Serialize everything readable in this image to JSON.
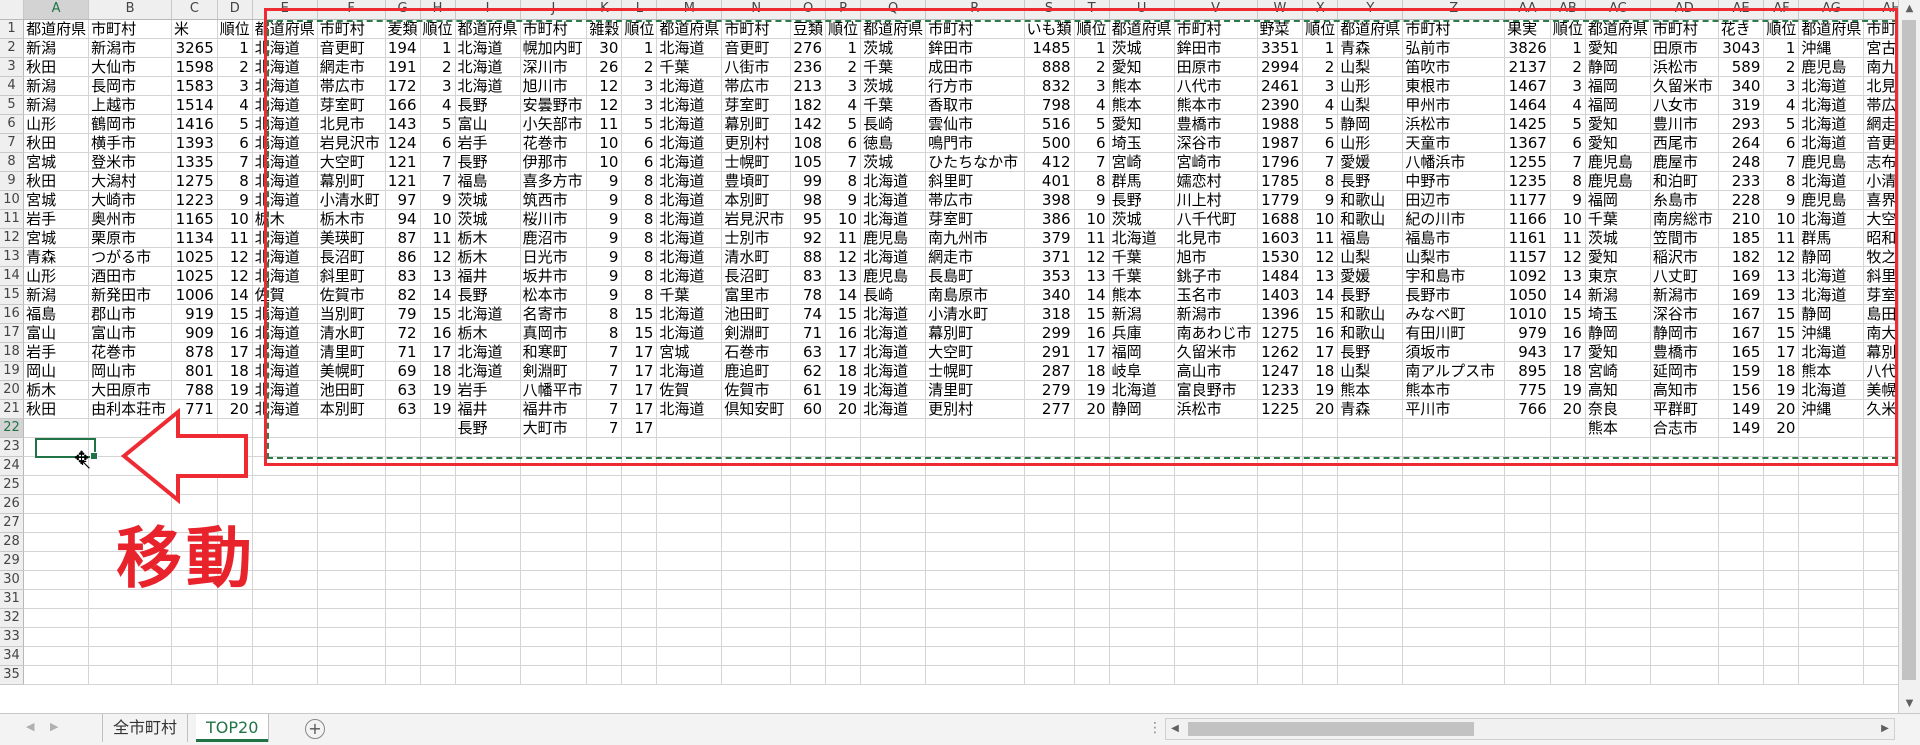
{
  "columns": [
    "A",
    "B",
    "C",
    "D",
    "E",
    "F",
    "G",
    "H",
    "I",
    "J",
    "K",
    "L",
    "M",
    "N",
    "O",
    "P",
    "Q",
    "R",
    "S",
    "T",
    "U",
    "V",
    "W",
    "X",
    "Y",
    "Z",
    "AA",
    "AB",
    "AC",
    "AD",
    "AE",
    "AF",
    "AG",
    "AH"
  ],
  "grid": {
    "active_cell": "A22",
    "rows": [
      [
        "都道府県",
        "市町村",
        "米",
        "順位",
        "都道府県",
        "市町村",
        "麦類",
        "順位",
        "都道府県",
        "市町村",
        "雑穀",
        "順位",
        "都道府県",
        "市町村",
        "豆類",
        "順位",
        "都道府県",
        "市町村",
        "いも類",
        "順位",
        "都道府県",
        "市町村",
        "野菜",
        "順位",
        "都道府県",
        "市町村",
        "果実",
        "順位",
        "都道府県",
        "市町村",
        "花き",
        "順位",
        "都道府県",
        "市町村"
      ],
      [
        "新潟",
        "新潟市",
        "3265",
        "1",
        "北海道",
        "音更町",
        "194",
        "1",
        "北海道",
        "幌加内町",
        "30",
        "1",
        "北海道",
        "音更町",
        "276",
        "1",
        "茨城",
        "鉾田市",
        "1485",
        "1",
        "茨城",
        "鉾田市",
        "3351",
        "1",
        "青森",
        "弘前市",
        "3826",
        "1",
        "愛知",
        "田原市",
        "3043",
        "1",
        "沖縄",
        "宮古島"
      ],
      [
        "秋田",
        "大仙市",
        "1598",
        "2",
        "北海道",
        "網走市",
        "191",
        "2",
        "北海道",
        "深川市",
        "26",
        "2",
        "千葉",
        "八街市",
        "236",
        "2",
        "千葉",
        "成田市",
        "888",
        "2",
        "愛知",
        "田原市",
        "2994",
        "2",
        "山梨",
        "笛吹市",
        "2137",
        "2",
        "静岡",
        "浜松市",
        "589",
        "2",
        "鹿児島",
        "南九州"
      ],
      [
        "新潟",
        "長岡市",
        "1583",
        "3",
        "北海道",
        "帯広市",
        "172",
        "3",
        "北海道",
        "旭川市",
        "12",
        "3",
        "北海道",
        "帯広市",
        "213",
        "3",
        "茨城",
        "行方市",
        "832",
        "3",
        "熊本",
        "八代市",
        "2461",
        "3",
        "山形",
        "東根市",
        "1467",
        "3",
        "福岡",
        "久留米市",
        "340",
        "3",
        "北海道",
        "北見市"
      ],
      [
        "新潟",
        "上越市",
        "1514",
        "4",
        "北海道",
        "芽室町",
        "166",
        "4",
        "長野",
        "安曇野市",
        "12",
        "3",
        "北海道",
        "芽室町",
        "182",
        "4",
        "千葉",
        "香取市",
        "798",
        "4",
        "熊本",
        "熊本市",
        "2390",
        "4",
        "山梨",
        "甲州市",
        "1464",
        "4",
        "福岡",
        "八女市",
        "319",
        "4",
        "北海道",
        "帯広市"
      ],
      [
        "山形",
        "鶴岡市",
        "1416",
        "5",
        "北海道",
        "北見市",
        "143",
        "5",
        "富山",
        "小矢部市",
        "11",
        "5",
        "北海道",
        "幕別町",
        "142",
        "5",
        "長崎",
        "雲仙市",
        "516",
        "5",
        "愛知",
        "豊橋市",
        "1988",
        "5",
        "静岡",
        "浜松市",
        "1425",
        "5",
        "愛知",
        "豊川市",
        "293",
        "5",
        "北海道",
        "網走市"
      ],
      [
        "秋田",
        "横手市",
        "1393",
        "6",
        "北海道",
        "岩見沢市",
        "124",
        "6",
        "岩手",
        "花巻市",
        "10",
        "6",
        "北海道",
        "更別村",
        "108",
        "6",
        "徳島",
        "鳴門市",
        "500",
        "6",
        "埼玉",
        "深谷市",
        "1987",
        "6",
        "山形",
        "天童市",
        "1367",
        "6",
        "愛知",
        "西尾市",
        "264",
        "6",
        "北海道",
        "音更町"
      ],
      [
        "宮城",
        "登米市",
        "1335",
        "7",
        "北海道",
        "大空町",
        "121",
        "7",
        "長野",
        "伊那市",
        "10",
        "6",
        "北海道",
        "士幌町",
        "105",
        "7",
        "茨城",
        "ひたちなか市",
        "412",
        "7",
        "宮崎",
        "宮崎市",
        "1796",
        "7",
        "愛媛",
        "八幡浜市",
        "1255",
        "7",
        "鹿児島",
        "鹿屋市",
        "248",
        "7",
        "鹿児島",
        "志布志"
      ],
      [
        "秋田",
        "大潟村",
        "1275",
        "8",
        "北海道",
        "幕別町",
        "121",
        "7",
        "福島",
        "喜多方市",
        "9",
        "8",
        "北海道",
        "豊頃町",
        "99",
        "8",
        "北海道",
        "斜里町",
        "401",
        "8",
        "群馬",
        "嬬恋村",
        "1785",
        "8",
        "長野",
        "中野市",
        "1235",
        "8",
        "鹿児島",
        "和泊町",
        "233",
        "8",
        "北海道",
        "小清水"
      ],
      [
        "宮城",
        "大崎市",
        "1223",
        "9",
        "北海道",
        "小清水町",
        "97",
        "9",
        "茨城",
        "筑西市",
        "9",
        "8",
        "北海道",
        "本別町",
        "98",
        "9",
        "北海道",
        "帯広市",
        "398",
        "9",
        "長野",
        "川上村",
        "1779",
        "9",
        "和歌山",
        "田辺市",
        "1177",
        "9",
        "福岡",
        "糸島市",
        "228",
        "9",
        "鹿児島",
        "喜界町"
      ],
      [
        "岩手",
        "奥州市",
        "1165",
        "10",
        "栃木",
        "栃木市",
        "94",
        "10",
        "茨城",
        "桜川市",
        "9",
        "8",
        "北海道",
        "岩見沢市",
        "95",
        "10",
        "北海道",
        "芽室町",
        "386",
        "10",
        "茨城",
        "八千代町",
        "1688",
        "10",
        "和歌山",
        "紀の川市",
        "1166",
        "10",
        "千葉",
        "南房総市",
        "210",
        "10",
        "北海道",
        "大空町"
      ],
      [
        "宮城",
        "栗原市",
        "1134",
        "11",
        "北海道",
        "美瑛町",
        "87",
        "11",
        "栃木",
        "鹿沼市",
        "9",
        "8",
        "北海道",
        "士別市",
        "92",
        "11",
        "鹿児島",
        "南九州市",
        "379",
        "11",
        "北海道",
        "北見市",
        "1603",
        "11",
        "福島",
        "福島市",
        "1161",
        "11",
        "茨城",
        "笠間市",
        "185",
        "11",
        "群馬",
        "昭和村"
      ],
      [
        "青森",
        "つがる市",
        "1025",
        "12",
        "北海道",
        "長沼町",
        "86",
        "12",
        "栃木",
        "日光市",
        "9",
        "8",
        "北海道",
        "清水町",
        "88",
        "12",
        "北海道",
        "網走市",
        "371",
        "12",
        "千葉",
        "旭市",
        "1530",
        "12",
        "山梨",
        "山梨市",
        "1157",
        "12",
        "愛知",
        "稲沢市",
        "182",
        "12",
        "静岡",
        "牧之原"
      ],
      [
        "山形",
        "酒田市",
        "1025",
        "12",
        "北海道",
        "斜里町",
        "83",
        "13",
        "福井",
        "坂井市",
        "9",
        "8",
        "北海道",
        "長沼町",
        "83",
        "13",
        "鹿児島",
        "長島町",
        "353",
        "13",
        "千葉",
        "銚子市",
        "1484",
        "13",
        "愛媛",
        "宇和島市",
        "1092",
        "13",
        "東京",
        "八丈町",
        "169",
        "13",
        "北海道",
        "斜里町"
      ],
      [
        "新潟",
        "新発田市",
        "1006",
        "14",
        "佐賀",
        "佐賀市",
        "82",
        "14",
        "長野",
        "松本市",
        "9",
        "8",
        "千葉",
        "富里市",
        "78",
        "14",
        "長崎",
        "南島原市",
        "340",
        "14",
        "熊本",
        "玉名市",
        "1403",
        "14",
        "長野",
        "長野市",
        "1050",
        "14",
        "新潟",
        "新潟市",
        "169",
        "13",
        "北海道",
        "芽室町"
      ],
      [
        "福島",
        "郡山市",
        "919",
        "15",
        "北海道",
        "当別町",
        "79",
        "15",
        "北海道",
        "名寄市",
        "8",
        "15",
        "北海道",
        "池田町",
        "74",
        "15",
        "北海道",
        "小清水町",
        "318",
        "15",
        "新潟",
        "新潟市",
        "1396",
        "15",
        "和歌山",
        "みなべ町",
        "1010",
        "15",
        "埼玉",
        "深谷市",
        "167",
        "15",
        "静岡",
        "島田市"
      ],
      [
        "富山",
        "富山市",
        "909",
        "16",
        "北海道",
        "清水町",
        "72",
        "16",
        "栃木",
        "真岡市",
        "8",
        "15",
        "北海道",
        "剣淵町",
        "71",
        "16",
        "北海道",
        "幕別町",
        "299",
        "16",
        "兵庫",
        "南あわじ市",
        "1275",
        "16",
        "和歌山",
        "有田川町",
        "979",
        "16",
        "静岡",
        "静岡市",
        "167",
        "15",
        "沖縄",
        "南大東"
      ],
      [
        "岩手",
        "花巻市",
        "878",
        "17",
        "北海道",
        "清里町",
        "71",
        "17",
        "北海道",
        "和寒町",
        "7",
        "17",
        "宮城",
        "石巻市",
        "63",
        "17",
        "北海道",
        "大空町",
        "291",
        "17",
        "福岡",
        "久留米市",
        "1262",
        "17",
        "長野",
        "須坂市",
        "943",
        "17",
        "愛知",
        "豊橋市",
        "165",
        "17",
        "北海道",
        "幕別町"
      ],
      [
        "岡山",
        "岡山市",
        "801",
        "18",
        "北海道",
        "美幌町",
        "69",
        "18",
        "北海道",
        "剣淵町",
        "7",
        "17",
        "北海道",
        "鹿追町",
        "62",
        "18",
        "北海道",
        "士幌町",
        "287",
        "18",
        "岐阜",
        "高山市",
        "1247",
        "18",
        "山梨",
        "南アルプス市",
        "895",
        "18",
        "宮崎",
        "延岡市",
        "159",
        "18",
        "熊本",
        "八代市"
      ],
      [
        "栃木",
        "大田原市",
        "788",
        "19",
        "北海道",
        "池田町",
        "63",
        "19",
        "岩手",
        "八幡平市",
        "7",
        "17",
        "佐賀",
        "佐賀市",
        "61",
        "19",
        "北海道",
        "清里町",
        "279",
        "19",
        "北海道",
        "富良野市",
        "1233",
        "19",
        "熊本",
        "熊本市",
        "775",
        "19",
        "高知",
        "高知市",
        "156",
        "19",
        "北海道",
        "美幌町"
      ],
      [
        "秋田",
        "由利本荘市",
        "771",
        "20",
        "北海道",
        "本別町",
        "63",
        "19",
        "福井",
        "福井市",
        "7",
        "17",
        "北海道",
        "倶知安町",
        "60",
        "20",
        "北海道",
        "更別村",
        "277",
        "20",
        "静岡",
        "浜松市",
        "1225",
        "20",
        "青森",
        "平川市",
        "766",
        "20",
        "奈良",
        "平群町",
        "149",
        "20",
        "沖縄",
        "久米島"
      ],
      [
        "",
        "",
        "",
        "",
        "",
        "",
        "",
        "",
        "長野",
        "大町市",
        "7",
        "17",
        "",
        "",
        "",
        "",
        "",
        "",
        "",
        "",
        "",
        "",
        "",
        "",
        "",
        "",
        "",
        "",
        "熊本",
        "合志市",
        "149",
        "20",
        "",
        ""
      ]
    ],
    "empty_row_count": 13
  },
  "annotation": {
    "text": "移動",
    "color": "#e8232c"
  },
  "sheet_tabs": [
    {
      "label": "全市町村"
    },
    {
      "label": "TOP20"
    }
  ],
  "active_tab": "TOP20",
  "accent_color": "#217346",
  "highlight_color": "#ee2b33"
}
